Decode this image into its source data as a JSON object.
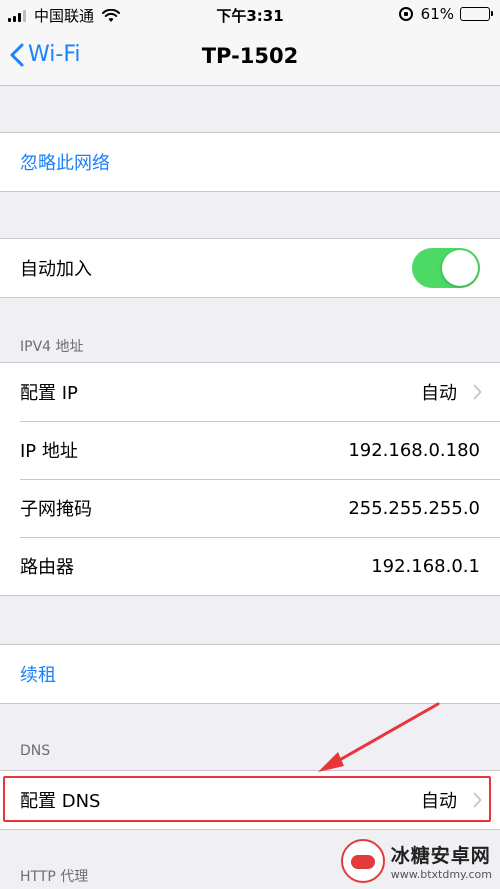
{
  "status_bar": {
    "carrier": "中国联通",
    "time": "下午3:31",
    "battery_percent": "61%",
    "battery_level": 0.61
  },
  "nav": {
    "back_label": "Wi-Fi",
    "title": "TP-1502"
  },
  "forget_network": {
    "label": "忽略此网络"
  },
  "auto_join": {
    "label": "自动加入",
    "enabled": true
  },
  "ipv4": {
    "header": "IPV4 地址",
    "rows": [
      {
        "label": "配置 IP",
        "value": "自动"
      },
      {
        "label": "IP 地址",
        "value": "192.168.0.180"
      },
      {
        "label": "子网掩码",
        "value": "255.255.255.0"
      },
      {
        "label": "路由器",
        "value": "192.168.0.1"
      }
    ]
  },
  "renew_lease": {
    "label": "续租"
  },
  "dns": {
    "header": "DNS",
    "row": {
      "label": "配置 DNS",
      "value": "自动"
    }
  },
  "http_proxy": {
    "header": "HTTP 代理"
  },
  "watermark": {
    "title": "冰糖安卓网",
    "url": "www.btxtdmy.com"
  },
  "colors": {
    "accent": "#1a82fb",
    "toggle_on": "#4cd964",
    "highlight": "#e8353b",
    "background": "#efeff4"
  }
}
